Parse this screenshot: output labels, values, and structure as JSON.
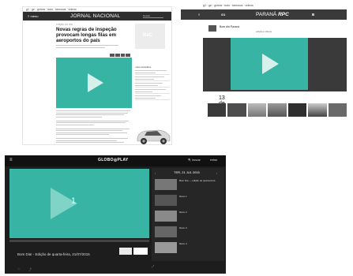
{
  "panel1": {
    "globobar": "g1 · ge · gshow · tudo · famosos · vídeos",
    "menu_label": "≡ menu",
    "brand": "JORNAL NACIONAL",
    "search_label": "buscar",
    "kicker": "edição do dia",
    "headline": "Novas regras de inspeção provocam longas filas em aeroportos do país",
    "ad_label": "ReC",
    "rail_title": "mais assistidos"
  },
  "panel2": {
    "globobar": "g1 · ge · gshow · tudo · famosos · vídeos",
    "menu_label": "≡",
    "home_label": "G1",
    "brand_prefix": "PARANÁ",
    "brand_suffix": "RPC",
    "program_title": "Bom dia Paraná",
    "tabs": "edições   vídeos",
    "more_label": "vídeos",
    "more_count": "13 de"
  },
  "panel3": {
    "menu_label": "≡",
    "brand": "GLOBO◎PLAY",
    "search_label": "🔍 buscar",
    "login_label": "entrar",
    "video_number": "1",
    "side_date": "TER, 21 JUL 2015",
    "side_items": [
      {
        "text": "Bom Dia — edição de quarta-feira"
      },
      {
        "text": "bloco 1"
      },
      {
        "text": "bloco 2"
      },
      {
        "text": "bloco 3"
      },
      {
        "text": "bloco 4"
      }
    ],
    "caption": "Bom Dia! - Edição de quarta-feira, 21/07/2015"
  },
  "colors": {
    "accent_teal": "#37b4a3",
    "dark_header": "#2e2e2e",
    "player_bg": "#1d1d1d"
  }
}
